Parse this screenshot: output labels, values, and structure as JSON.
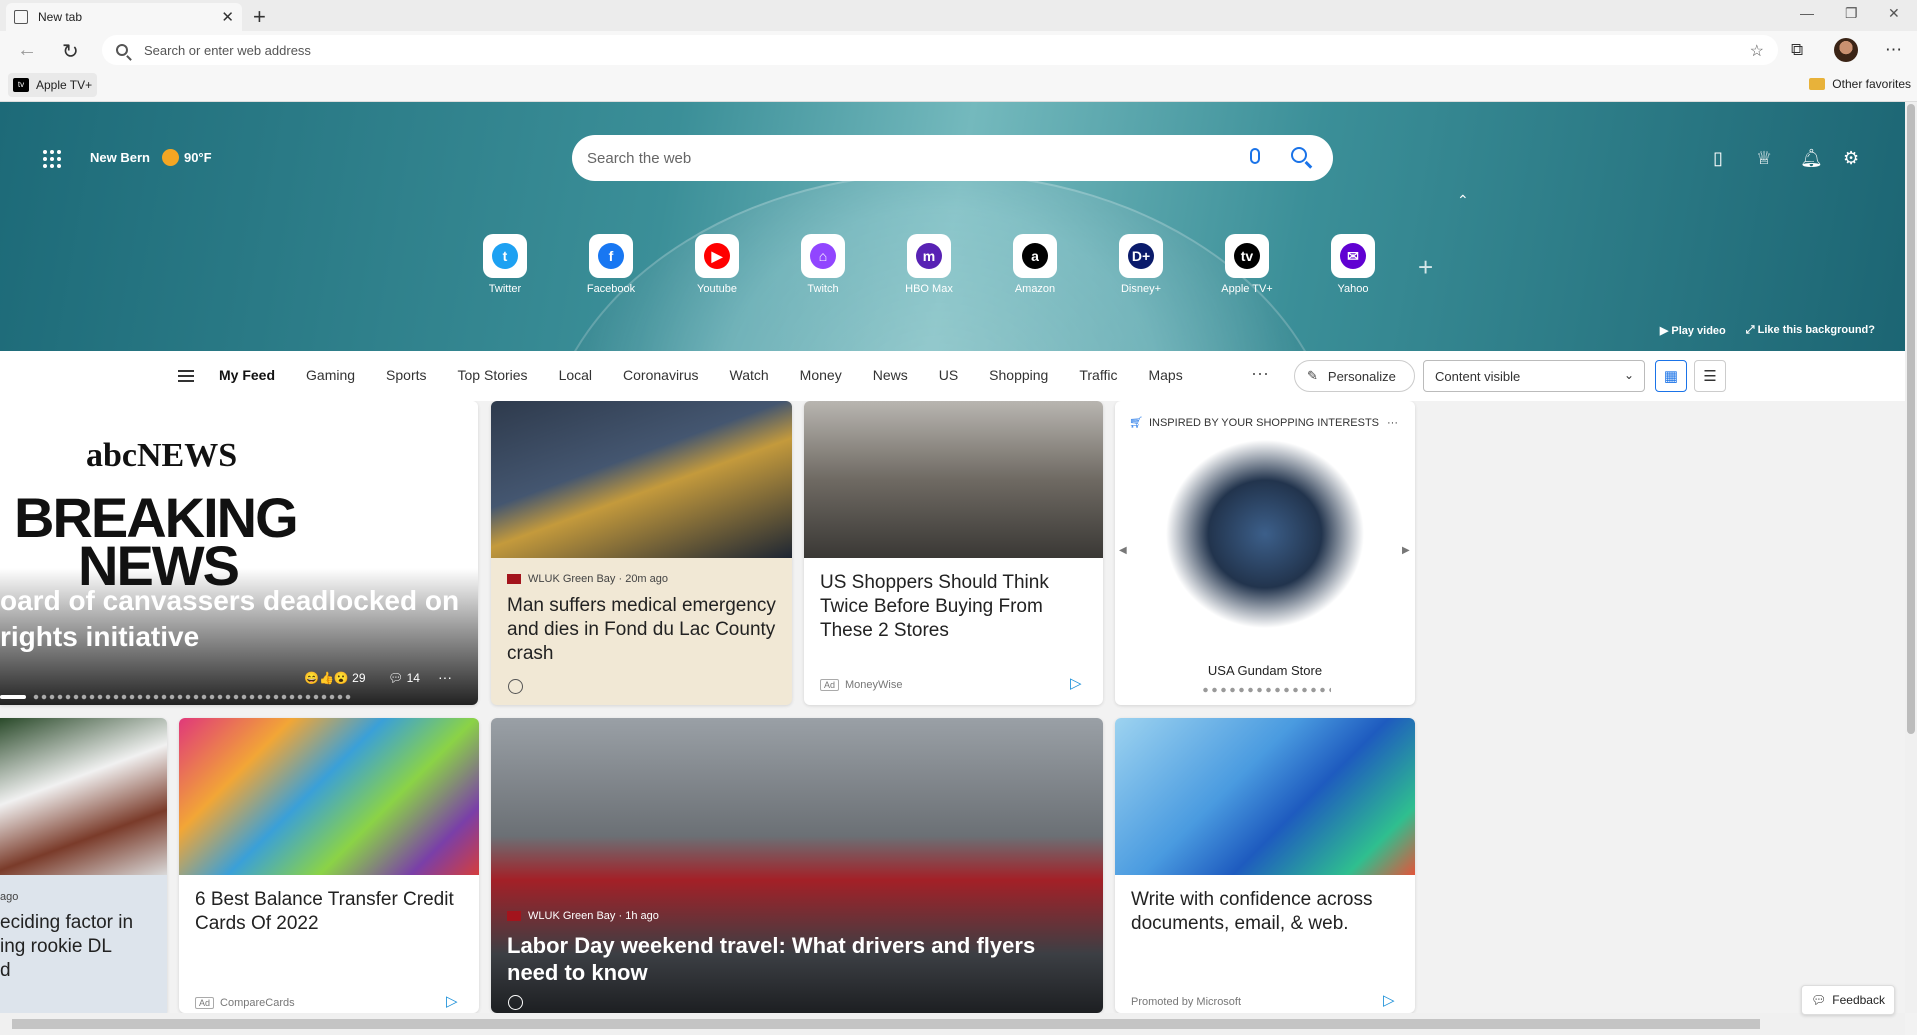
{
  "browser": {
    "tab_title": "New tab",
    "address_placeholder": "Search or enter web address",
    "favorites": [
      {
        "label": "Apple TV+",
        "icon": "tv"
      }
    ],
    "other_favorites": "Other favorites"
  },
  "hero": {
    "location": "New Bern",
    "temperature": "90°F",
    "search_placeholder": "Search the web",
    "quick_links": [
      {
        "label": "Twitter",
        "glyph": "t",
        "color": "#1da1f2"
      },
      {
        "label": "Facebook",
        "glyph": "f",
        "color": "#1877f2"
      },
      {
        "label": "Youtube",
        "glyph": "▶",
        "color": "#ff0000"
      },
      {
        "label": "Twitch",
        "glyph": "⌂",
        "color": "#9146ff"
      },
      {
        "label": "HBO Max",
        "glyph": "m",
        "color": "#5822b4"
      },
      {
        "label": "Amazon",
        "glyph": "a",
        "color": "#000000"
      },
      {
        "label": "Disney+",
        "glyph": "D+",
        "color": "#0b1b6b"
      },
      {
        "label": "Apple TV+",
        "glyph": "tv",
        "color": "#000000"
      },
      {
        "label": "Yahoo",
        "glyph": "✉",
        "color": "#6001d2"
      }
    ],
    "play_video": "Play video",
    "like_background": "Like this background?"
  },
  "feed": {
    "tabs": [
      "My Feed",
      "Gaming",
      "Sports",
      "Top Stories",
      "Local",
      "Coronavirus",
      "Watch",
      "Money",
      "News",
      "US",
      "Shopping",
      "Traffic",
      "Maps"
    ],
    "active_tab": "My Feed",
    "personalize": "Personalize",
    "content_select": "Content visible"
  },
  "cards": {
    "abc": {
      "brand": "abcNEWS",
      "banner_line1": "BREAKING",
      "banner_line2": "NEWS",
      "headline": "oard of canvassers deadlocked on\nrights initiative",
      "reactions": "29",
      "comments": "14"
    },
    "sheriff": {
      "source": "WLUK Green Bay · 20m ago",
      "headline": "Man suffers medical emergency and dies in Fond du Lac County crash"
    },
    "shoppers": {
      "headline": "US Shoppers Should Think Twice Before Buying From These 2 Stores",
      "ad_label": "Ad",
      "sponsor": "MoneyWise"
    },
    "gundam": {
      "header": "INSPIRED BY YOUR SHOPPING INTERESTS",
      "store": "USA Gundam Store"
    },
    "football": {
      "meta": "ago",
      "headline": "eciding factor in\ning rookie DL\nd"
    },
    "credit": {
      "headline": "6 Best Balance Transfer Credit Cards Of 2022",
      "ad_label": "Ad",
      "sponsor": "CompareCards"
    },
    "travel": {
      "source": "WLUK Green Bay · 1h ago",
      "headline": "Labor Day weekend travel: What drivers and flyers need to know"
    },
    "word": {
      "headline": "Write with confidence across documents, email, & web.",
      "sponsor": "Promoted by Microsoft"
    }
  },
  "feedback": "Feedback"
}
